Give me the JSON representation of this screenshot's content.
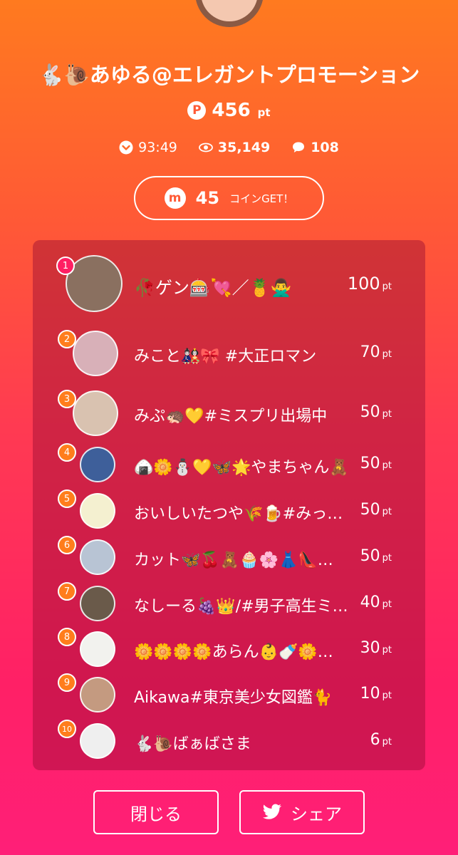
{
  "profile": {
    "name": "🐇🐌あゆる@エレガントプロモーション",
    "points_icon": "P",
    "points": "456",
    "points_unit": "pt"
  },
  "stats": {
    "duration": "93:49",
    "views": "35,149",
    "comments": "108"
  },
  "coin": {
    "icon": "m",
    "count": "45",
    "label": "コインGET！"
  },
  "ranking": [
    {
      "rank": "1",
      "name": "🥀ゲン🎰💘／🍍🙅‍♂️",
      "points": "100",
      "unit": "pt",
      "avatar_color": "#8a7060"
    },
    {
      "rank": "2",
      "name": "みこと🎎🎀 #大正ロマン",
      "points": "70",
      "unit": "pt",
      "avatar_color": "#d8b0b8"
    },
    {
      "rank": "3",
      "name": "みぷ🦔💛#ミスプリ出場中",
      "points": "50",
      "unit": "pt",
      "avatar_color": "#d9c2b0"
    },
    {
      "rank": "4",
      "name": "🍙🌼⛄💛🦋🌟やまちゃん🧸",
      "points": "50",
      "unit": "pt",
      "avatar_color": "#3e5f9a"
    },
    {
      "rank": "5",
      "name": "おいしいたつや🌾🍺#みっくちゅ",
      "points": "50",
      "unit": "pt",
      "avatar_color": "#f4f0d0"
    },
    {
      "rank": "6",
      "name": "カット🦋🍒🧸🧁🌸👗👠🍀🦋",
      "points": "50",
      "unit": "pt",
      "avatar_color": "#b8c4d4"
    },
    {
      "rank": "7",
      "name": "なしーる🍇👑/#男子高生ミスコン",
      "points": "40",
      "unit": "pt",
      "avatar_color": "#6a5a4a"
    },
    {
      "rank": "8",
      "name": "🌼🌼🌼🌼あらん👶🍼🌼🌼🌼🌼",
      "points": "30",
      "unit": "pt",
      "avatar_color": "#f2f2ee"
    },
    {
      "rank": "9",
      "name": "Aikawa#東京美少女図鑑🐈",
      "points": "10",
      "unit": "pt",
      "avatar_color": "#c49a80"
    },
    {
      "rank": "10",
      "name": "🐇🐌ばぁばさま",
      "points": "6",
      "unit": "pt",
      "avatar_color": "#efefef"
    }
  ],
  "buttons": {
    "close": "閉じる",
    "share": "シェア"
  },
  "colors": {
    "gradient_top": "#ff7a1f",
    "gradient_bottom": "#ff1f78",
    "panel": "#a0103a",
    "badge_first": "#ff1f63",
    "badge": "#ff7d1c"
  }
}
